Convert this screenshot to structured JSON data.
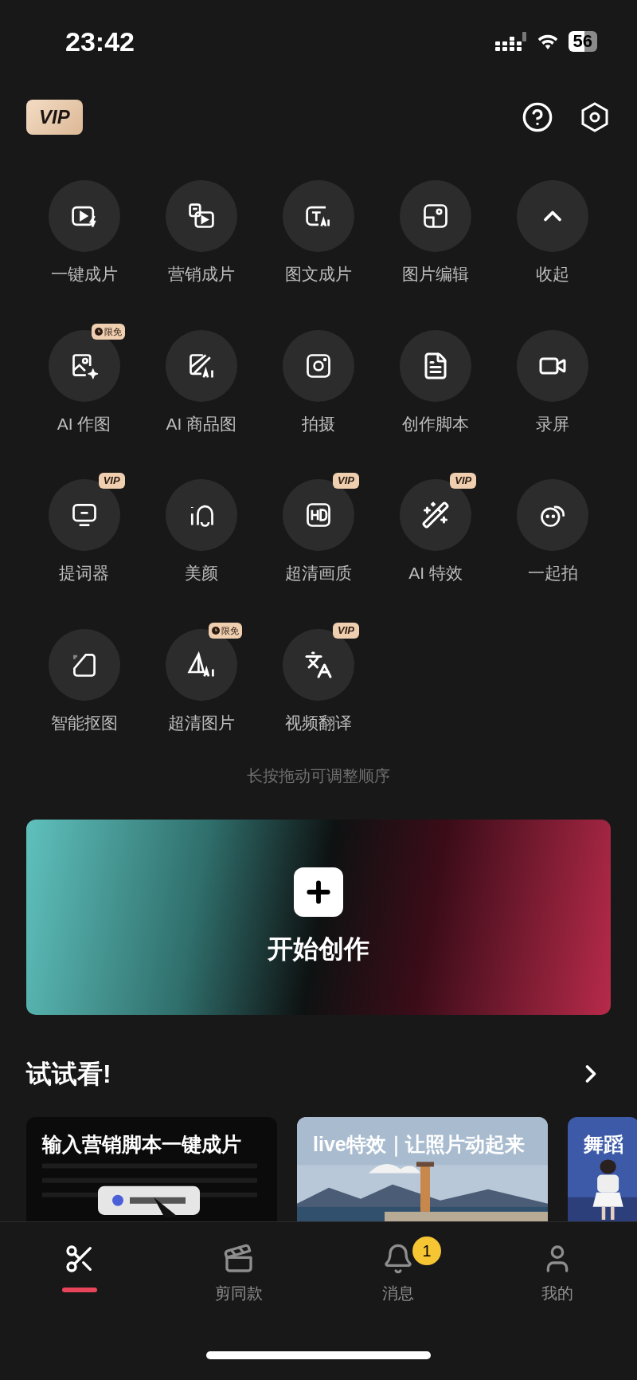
{
  "status_bar": {
    "time": "23:42",
    "battery": "56"
  },
  "header": {
    "vip_badge": "VIP"
  },
  "tools": [
    {
      "label": "一键成片"
    },
    {
      "label": "营销成片"
    },
    {
      "label": "图文成片"
    },
    {
      "label": "图片编辑"
    },
    {
      "label": "收起"
    },
    {
      "label": "AI 作图",
      "badge": {
        "kind": "free",
        "text": "限免"
      }
    },
    {
      "label": "AI 商品图"
    },
    {
      "label": "拍摄"
    },
    {
      "label": "创作脚本"
    },
    {
      "label": "录屏"
    },
    {
      "label": "提词器",
      "badge": {
        "kind": "vip",
        "text": "VIP"
      }
    },
    {
      "label": "美颜"
    },
    {
      "label": "超清画质",
      "badge": {
        "kind": "vip",
        "text": "VIP"
      }
    },
    {
      "label": "AI 特效",
      "badge": {
        "kind": "vip",
        "text": "VIP"
      }
    },
    {
      "label": "一起拍"
    },
    {
      "label": "智能抠图"
    },
    {
      "label": "超清图片",
      "badge": {
        "kind": "free",
        "text": "限免"
      }
    },
    {
      "label": "视频翻译",
      "badge": {
        "kind": "vip",
        "text": "VIP"
      }
    }
  ],
  "hint": "长按拖动可调整顺序",
  "create_button": {
    "label": "开始创作"
  },
  "try_section": {
    "title": "试试看!",
    "cards": [
      {
        "title": "输入营销脚本一键成片"
      },
      {
        "title": "live特效｜让照片动起来"
      },
      {
        "title": "舞蹈"
      }
    ]
  },
  "tab_bar": [
    {
      "selected": true
    },
    {
      "label": "剪同款",
      "selected": false
    },
    {
      "label": "消息",
      "selected": false,
      "badge": "1"
    },
    {
      "label": "我的",
      "selected": false
    }
  ]
}
